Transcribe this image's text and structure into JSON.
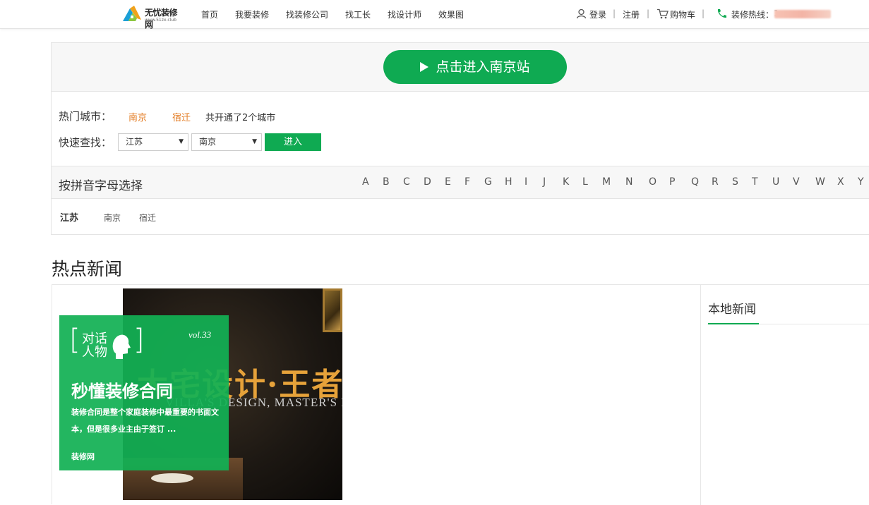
{
  "header": {
    "logo_name": "无忧装修网",
    "logo_url": "www.51zx.club",
    "nav": [
      "首页",
      "我要装修",
      "找装修公司",
      "找工长",
      "找设计师",
      "效果图"
    ],
    "login": "登录",
    "register": "注册",
    "cart": "购物车",
    "hotline_label": "装修热线：",
    "hotline_prefix": "1",
    "separator": "|"
  },
  "city": {
    "enter_station": "点击进入南京站",
    "hot_label": "热门城市：",
    "hot_cities": [
      "南京",
      "宿迁"
    ],
    "opened_note": "共开通了2个城市",
    "quick_label": "快速查找：",
    "province_select": "江苏",
    "city_select": "南京",
    "go_button": "进入",
    "pinyin_title": "按拼音字母选择",
    "letters": [
      "A",
      "B",
      "C",
      "D",
      "E",
      "F",
      "G",
      "H",
      "I",
      "J",
      "K",
      "L",
      "M",
      "N",
      "O",
      "P",
      "Q",
      "R",
      "S",
      "T",
      "U",
      "V",
      "W",
      "X",
      "Y"
    ],
    "province": "江苏",
    "province_cities": [
      "南京",
      "宿迁"
    ]
  },
  "news": {
    "title": "热点新闻",
    "local_tab": "本地新闻",
    "feature": {
      "bracket_open": "[",
      "bracket_close": "]",
      "talk_line1": "对话",
      "talk_line2": "人物",
      "vol": "vol.33",
      "headline": "秒懂装修合同",
      "description": "装修合同是整个家庭装修中最重要的书面文本，但是很多业主由于签订 ...",
      "source": "装修网",
      "image_title": "大宅设计·王者之",
      "image_subtitle": "VILLA'S DESIGN, MASTER'S RES"
    }
  },
  "colors": {
    "brand_green": "#0faa52",
    "hot_orange": "#e37b22"
  }
}
